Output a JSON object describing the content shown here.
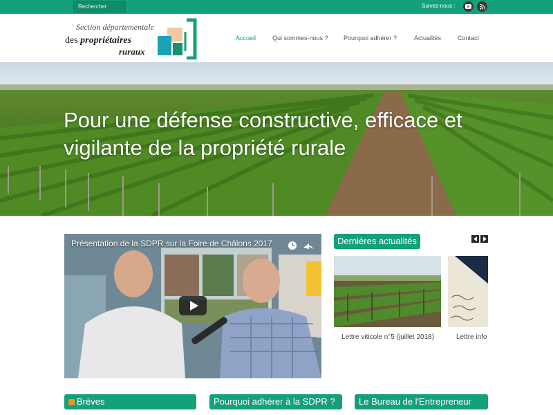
{
  "topbar": {
    "search_label": "Rechercher",
    "follow_label": "Suivez-nous :",
    "social_icons": [
      "youtube-icon",
      "rss-icon"
    ]
  },
  "logo": {
    "line1": "Section départementale",
    "line2_prefix": "des ",
    "line2_bold": "propriétaires",
    "line3": "ruraux"
  },
  "nav": {
    "items": [
      {
        "label": "Accueil",
        "active": true
      },
      {
        "label": "Qui sommes-nous ?"
      },
      {
        "label": "Pourquoi adhérer ?"
      },
      {
        "label": "Actualités"
      },
      {
        "label": "Contact"
      }
    ]
  },
  "hero": {
    "title": "Pour une défense constructive, efficace et vigilante de la propriété rurale"
  },
  "video": {
    "title": "Présentation de la SDPR sur la Foire de Châlons 2017"
  },
  "news": {
    "heading": "Dernières actualités",
    "items": [
      {
        "caption": "Lettre viticole n°5 (juillet 2018)"
      },
      {
        "caption": "Lettre info"
      }
    ]
  },
  "boxes": {
    "breves": "Brèves",
    "pourquoi": "Pourquoi adhérer à la SDPR ?",
    "bureau": "Le Bureau de l'Entrepreneur"
  },
  "colors": {
    "accent": "#14a07a",
    "dark": "#2a2a2a"
  }
}
